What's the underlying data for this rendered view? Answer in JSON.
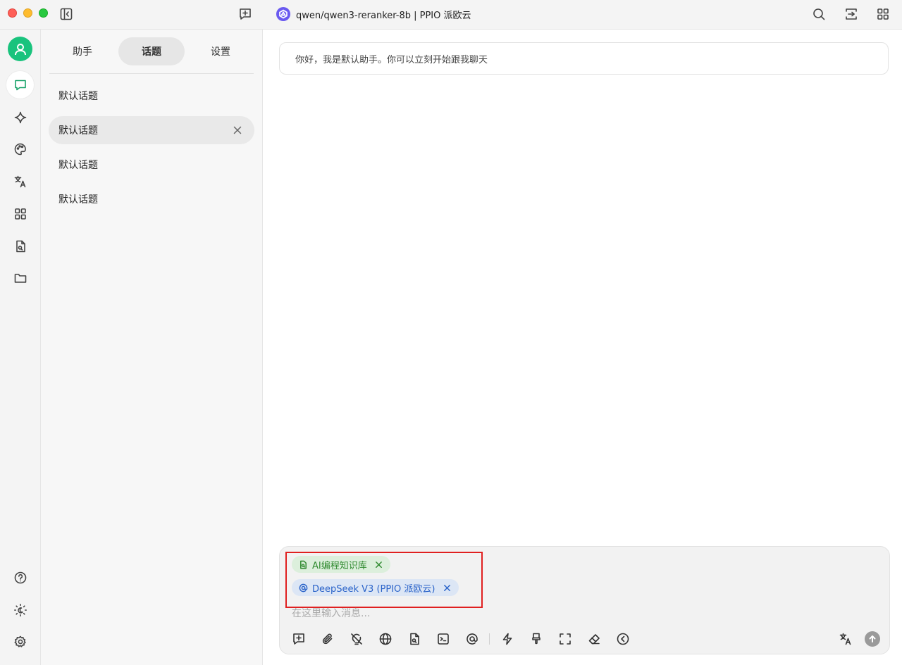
{
  "window": {
    "title": "qwen/qwen3-reranker-8b | PPIO 派欧云",
    "model_logo_icon": "model-logo-icon"
  },
  "titlebar": {
    "icons": [
      "sidebar-toggle-icon",
      "new-topic-icon",
      "search-icon",
      "expand-icon",
      "grid-icon"
    ]
  },
  "rail": {
    "items": [
      {
        "name": "chat-icon",
        "active": true
      },
      {
        "name": "sparkle-icon",
        "active": false
      },
      {
        "name": "palette-icon",
        "active": false
      },
      {
        "name": "translate-icon",
        "active": false
      },
      {
        "name": "apps-icon",
        "active": false
      },
      {
        "name": "file-search-icon",
        "active": false
      },
      {
        "name": "folder-icon",
        "active": false
      }
    ],
    "bottom": [
      "help-icon",
      "theme-icon",
      "settings-icon"
    ],
    "accent": "#19c37d"
  },
  "panel": {
    "tabs": [
      {
        "label": "助手",
        "active": false
      },
      {
        "label": "话题",
        "active": true
      },
      {
        "label": "设置",
        "active": false
      }
    ],
    "topics": [
      {
        "label": "默认话题",
        "active": false
      },
      {
        "label": "默认话题",
        "active": true
      },
      {
        "label": "默认话题",
        "active": false
      },
      {
        "label": "默认话题",
        "active": false
      }
    ]
  },
  "chat": {
    "greeting": "你好，我是默认助手。你可以立刻开始跟我聊天"
  },
  "composer": {
    "knowledge_chip": "AI编程知识库",
    "model_chip": "DeepSeek V3 (PPIO 派欧云)",
    "placeholder": "在这里输入消息...",
    "highlight_color": "#e02020",
    "send_color": "#9a9a9a"
  }
}
